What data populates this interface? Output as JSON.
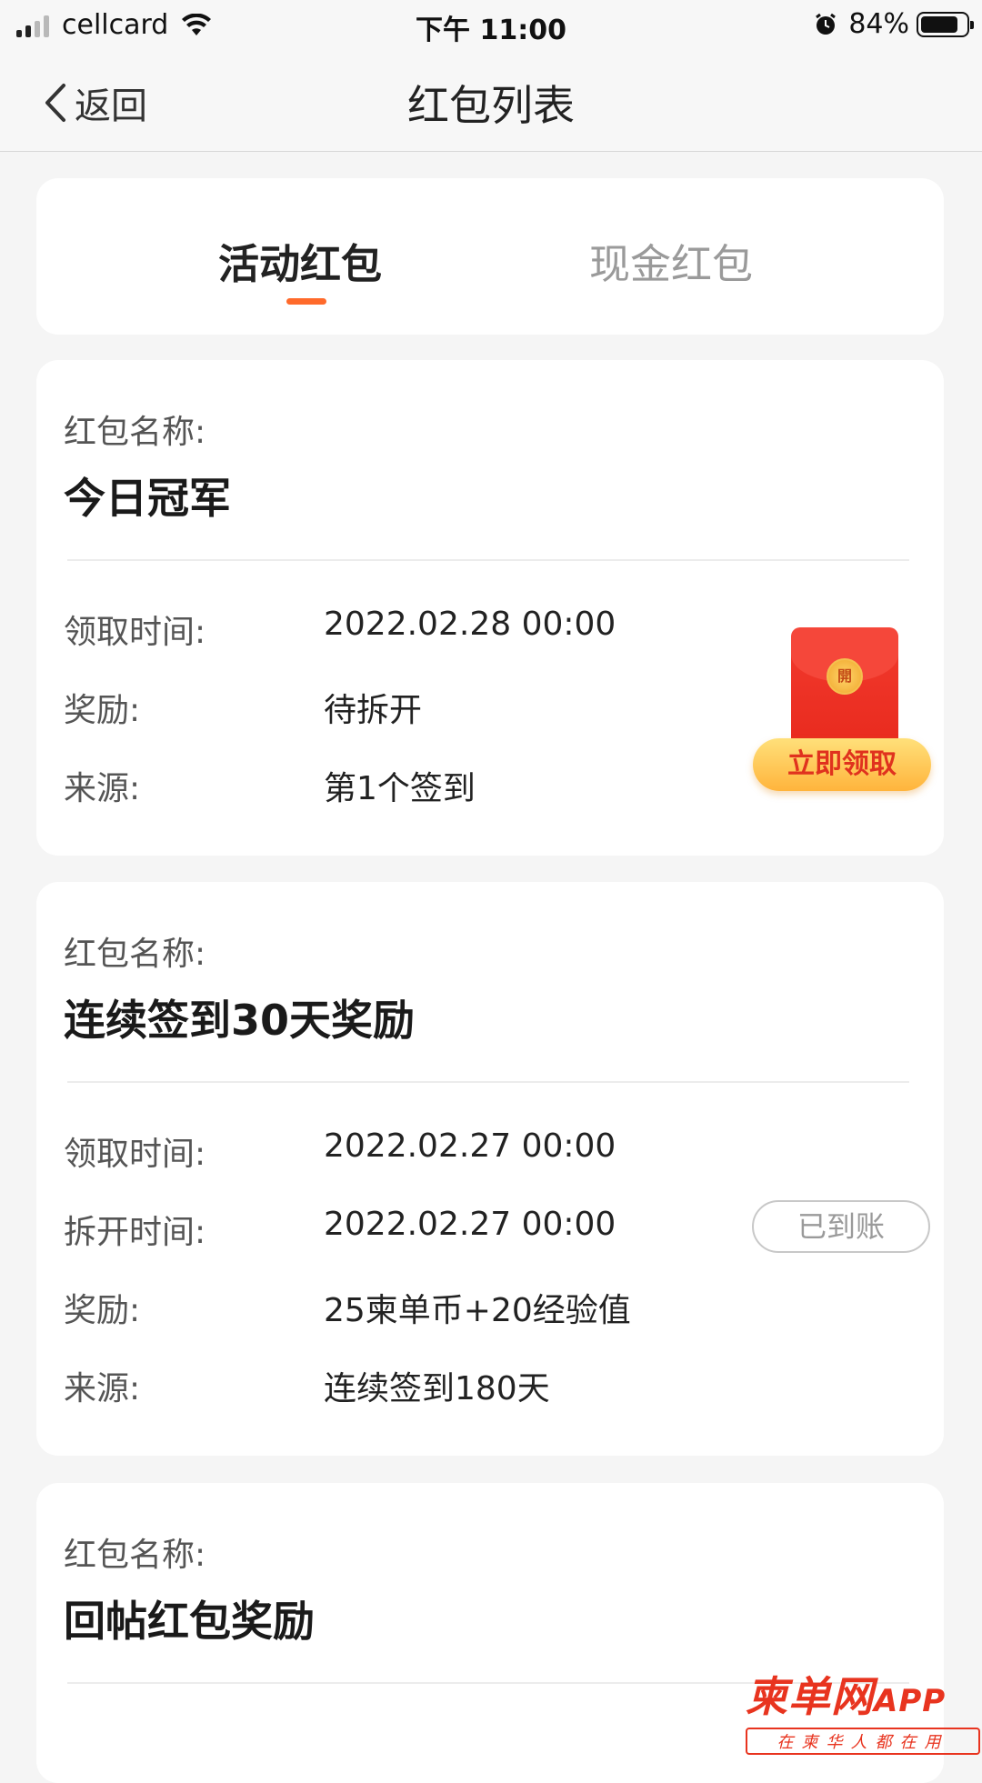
{
  "status_bar": {
    "carrier": "cellcard",
    "time": "下午 11:00",
    "battery_percent": "84%",
    "battery_level": 0.84,
    "icons": [
      "signal-icon",
      "wifi-icon",
      "alarm-icon",
      "battery-icon"
    ]
  },
  "nav": {
    "back_label": "返回",
    "title": "红包列表"
  },
  "tabs": [
    {
      "label": "活动红包",
      "active": true
    },
    {
      "label": "现金红包",
      "active": false
    }
  ],
  "colors": {
    "accent": "#ff6a2b",
    "envelope_red": "#e8291d",
    "claim_gold": "#ffb43c"
  },
  "cards": [
    {
      "name_label": "红包名称:",
      "name": "今日冠军",
      "rows": [
        {
          "label": "领取时间:",
          "value": "2022.02.28 00:00"
        },
        {
          "label": "奖励:",
          "value": "待拆开"
        },
        {
          "label": "来源:",
          "value": "第1个签到"
        }
      ],
      "envelope_seal": "開",
      "action_label": "立即领取"
    },
    {
      "name_label": "红包名称:",
      "name": "连续签到30天奖励",
      "rows": [
        {
          "label": "领取时间:",
          "value": "2022.02.27 00:00"
        },
        {
          "label": "拆开时间:",
          "value": "2022.02.27 00:00"
        },
        {
          "label": "奖励:",
          "value": "25柬单币+20经验值"
        },
        {
          "label": "来源:",
          "value": "连续签到180天"
        }
      ],
      "status_label": "已到账"
    },
    {
      "name_label": "红包名称:",
      "name": "回帖红包奖励"
    }
  ],
  "watermark": {
    "brand": "柬单网",
    "suffix": "APP",
    "slogan": "在柬华人都在用"
  }
}
